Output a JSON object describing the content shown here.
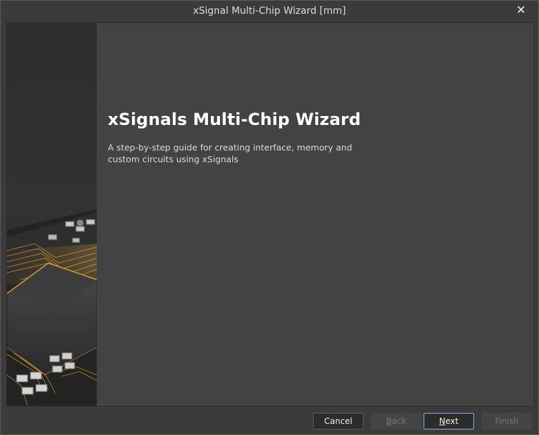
{
  "window": {
    "title": "xSignal Multi-Chip Wizard [mm]",
    "close_glyph": "✕"
  },
  "wizard": {
    "heading": "xSignals Multi-Chip Wizard",
    "description": "A step-by-step guide for creating interface, memory and custom circuits using xSignals"
  },
  "buttons": {
    "cancel": "Cancel",
    "back_first": "B",
    "back_rest": "ack",
    "next_first": "N",
    "next_rest": "ext",
    "finish": "Finish"
  },
  "side_image": {
    "icon": "pcb-chip-illustration"
  },
  "colors": {
    "background": "#3b3b3b",
    "content": "#434343",
    "accent_focus": "#8ab4e0",
    "trace_gold": "#f0a830"
  }
}
